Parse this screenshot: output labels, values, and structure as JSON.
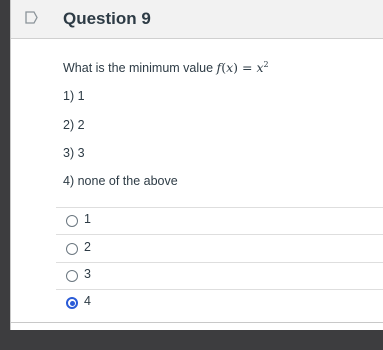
{
  "question": {
    "title": "Question 9",
    "prompt": "What is the minimum value",
    "formula": {
      "fn": "f",
      "var": "x",
      "base": "x",
      "exp": "2"
    },
    "options_text": [
      "1) 1",
      "2) 2",
      "3) 3",
      "4) none of the above"
    ],
    "answers": [
      {
        "label": "1",
        "selected": false
      },
      {
        "label": "2",
        "selected": false
      },
      {
        "label": "3",
        "selected": false
      },
      {
        "label": "4",
        "selected": true
      }
    ]
  },
  "colors": {
    "accent": "#2a5bd7",
    "text": "#2d3b45",
    "header_bg": "#f2f2f2"
  },
  "icons": {
    "flag": "flag-icon"
  }
}
